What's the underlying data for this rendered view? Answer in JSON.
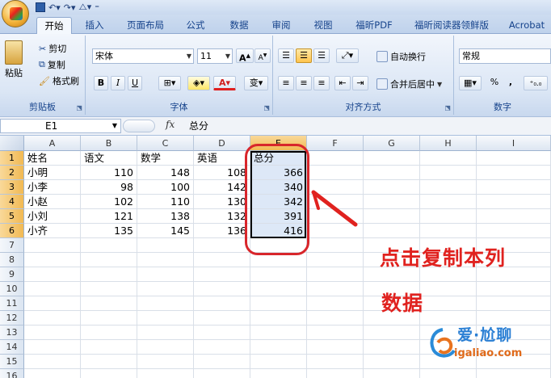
{
  "ribbon_tabs": [
    "开始",
    "插入",
    "页面布局",
    "公式",
    "数据",
    "审阅",
    "视图",
    "福昕PDF",
    "福昕阅读器领鲜版",
    "Acrobat"
  ],
  "clipboard": {
    "paste": "粘贴",
    "cut": "剪切",
    "copy": "复制",
    "format_painter": "格式刷",
    "label": "剪贴板"
  },
  "font": {
    "name": "宋体",
    "size": "11",
    "bold": "B",
    "italic": "I",
    "underline": "U",
    "grow": "A",
    "shrink": "A",
    "label": "字体"
  },
  "alignment": {
    "wrap": "自动换行",
    "merge": "合并后居中",
    "label": "对齐方式"
  },
  "number": {
    "format": "常规",
    "percent": "%",
    "comma": ",",
    "label": "数字"
  },
  "formula_bar": {
    "name_box": "E1",
    "fx": "fx",
    "formula": "总分"
  },
  "columns": [
    "A",
    "B",
    "C",
    "D",
    "E",
    "F",
    "G",
    "H",
    "I"
  ],
  "rows": [
    "1",
    "2",
    "3",
    "4",
    "5",
    "6",
    "7",
    "8",
    "9",
    "10",
    "11",
    "12",
    "13",
    "14",
    "15",
    "16"
  ],
  "table": {
    "header": [
      "姓名",
      "语文",
      "数学",
      "英语",
      "总分"
    ],
    "data": [
      [
        "小明",
        "110",
        "148",
        "108",
        "366"
      ],
      [
        "小李",
        "98",
        "100",
        "142",
        "340"
      ],
      [
        "小赵",
        "102",
        "110",
        "130",
        "342"
      ],
      [
        "小刘",
        "121",
        "138",
        "132",
        "391"
      ],
      [
        "小齐",
        "135",
        "145",
        "136",
        "416"
      ]
    ]
  },
  "annotation": {
    "line1": "点击复制本列",
    "line2": "数据"
  },
  "watermark": {
    "site": "爱·尬聊",
    "url": "igaliao.com"
  },
  "colors": {
    "annotation_red": "#e0221f",
    "selection_header": "#f1b953",
    "ribbon_blue": "#15428b"
  }
}
